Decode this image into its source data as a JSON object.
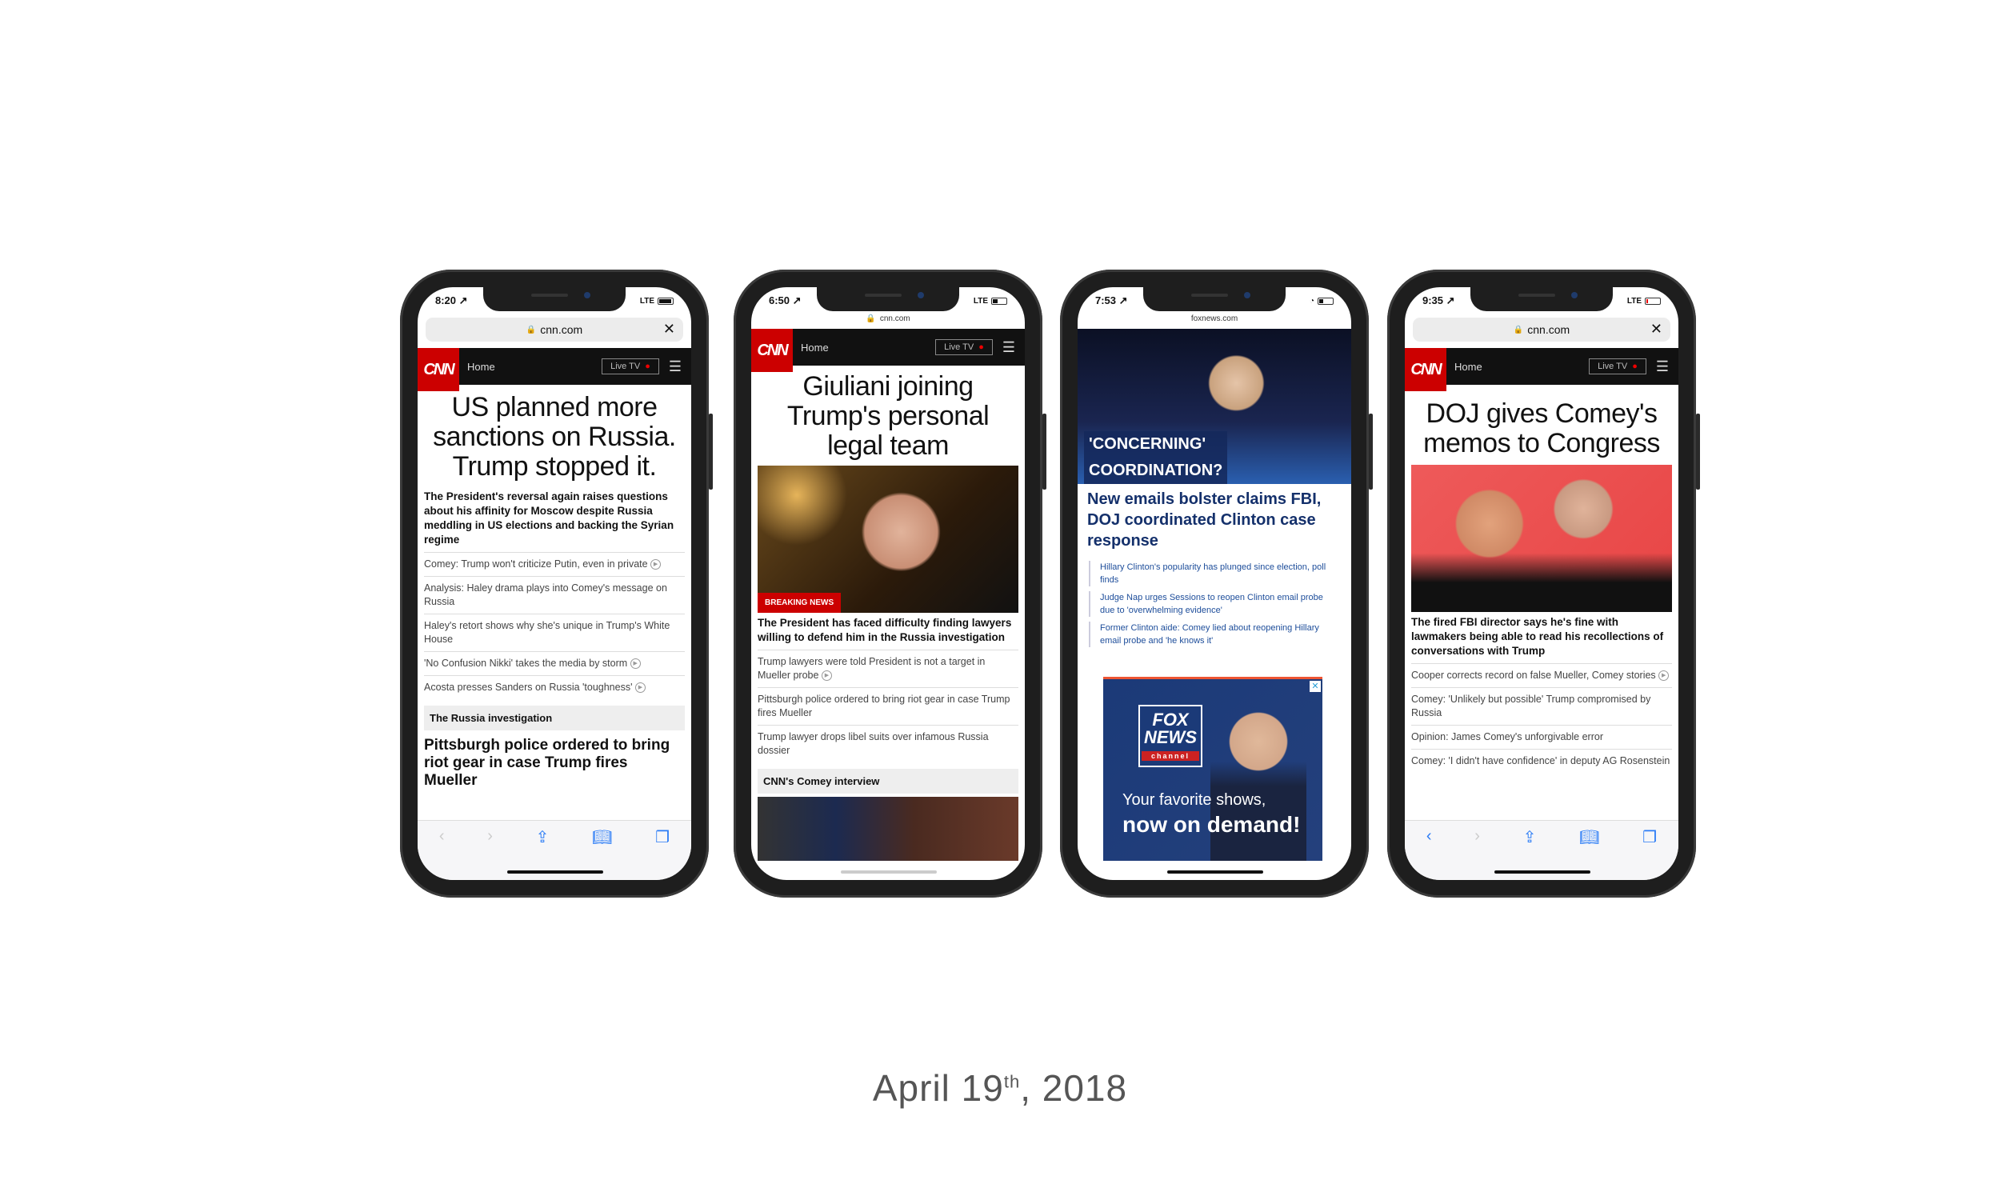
{
  "date": {
    "main": "April 19",
    "suffix": "th",
    "year": ", 2018"
  },
  "phones": [
    {
      "time": "8:20 ↗",
      "network": "LTE",
      "url": "cnn.com",
      "nav": {
        "home": "Home",
        "live": "Live TV"
      },
      "headline": "US planned more sanctions on Russia. Trump stopped it.",
      "sub": "The President's reversal again raises questions about his affinity for Moscow despite Russia meddling in US elections and backing the Syrian regime",
      "items": [
        "Comey: Trump won't criticize Putin, even in private",
        "Analysis: Haley drama plays into Comey's message on Russia",
        "Haley's retort shows why she's unique in Trump's White House",
        "'No Confusion Nikki' takes the media by storm",
        "Acosta presses Sanders on Russia 'toughness'"
      ],
      "section": "The Russia investigation",
      "section_headline": "Pittsburgh police ordered to bring riot gear in case Trump fires Mueller"
    },
    {
      "time": "6:50 ↗",
      "network": "LTE",
      "url": "cnn.com",
      "nav": {
        "home": "Home",
        "live": "Live TV"
      },
      "headline": "Giuliani joining Trump's personal legal team",
      "badge": "BREAKING NEWS",
      "sub": "The President has faced difficulty finding lawyers willing to defend him in the Russia investigation",
      "items": [
        "Trump lawyers were told President is not a target in Mueller probe",
        "Pittsburgh police ordered to bring riot gear in case Trump fires Mueller",
        "Trump lawyer drops libel suits over infamous Russia dossier"
      ],
      "section": "CNN's Comey interview"
    },
    {
      "time": "7:53 ↗",
      "url": "foxnews.com",
      "tag1": "'CONCERNING'",
      "tag2": "COORDINATION?",
      "headline": "New emails bolster claims FBI, DOJ coordinated Clinton case response",
      "links": [
        "Hillary Clinton's popularity has plunged since election, poll finds",
        "Judge Nap urges Sessions to reopen Clinton email probe due to 'overwhelming evidence'",
        "Former Clinton aide: Comey lied about reopening Hillary email probe and 'he knows it'"
      ],
      "ad": {
        "logo1": "FOX",
        "logo2": "NEWS",
        "logo3": "channel",
        "line1": "Your favorite shows,",
        "line2": "now on demand!"
      }
    },
    {
      "time": "9:35 ↗",
      "network": "LTE",
      "url": "cnn.com",
      "nav": {
        "home": "Home",
        "live": "Live TV"
      },
      "headline": "DOJ gives Comey's memos to Congress",
      "sub": "The fired FBI director says he's fine with lawmakers being able to read his recollections of conversations with Trump",
      "items": [
        "Cooper corrects record on false Mueller, Comey stories",
        "Comey: 'Unlikely but possible' Trump compromised by Russia",
        "Opinion: James Comey's unforgivable error",
        "Comey: 'I didn't have confidence' in deputy AG Rosenstein"
      ]
    }
  ],
  "colors": {
    "cnn_red": "#cc0000",
    "fox_blue": "#14306b",
    "safari_blue": "#2b7cf6"
  }
}
